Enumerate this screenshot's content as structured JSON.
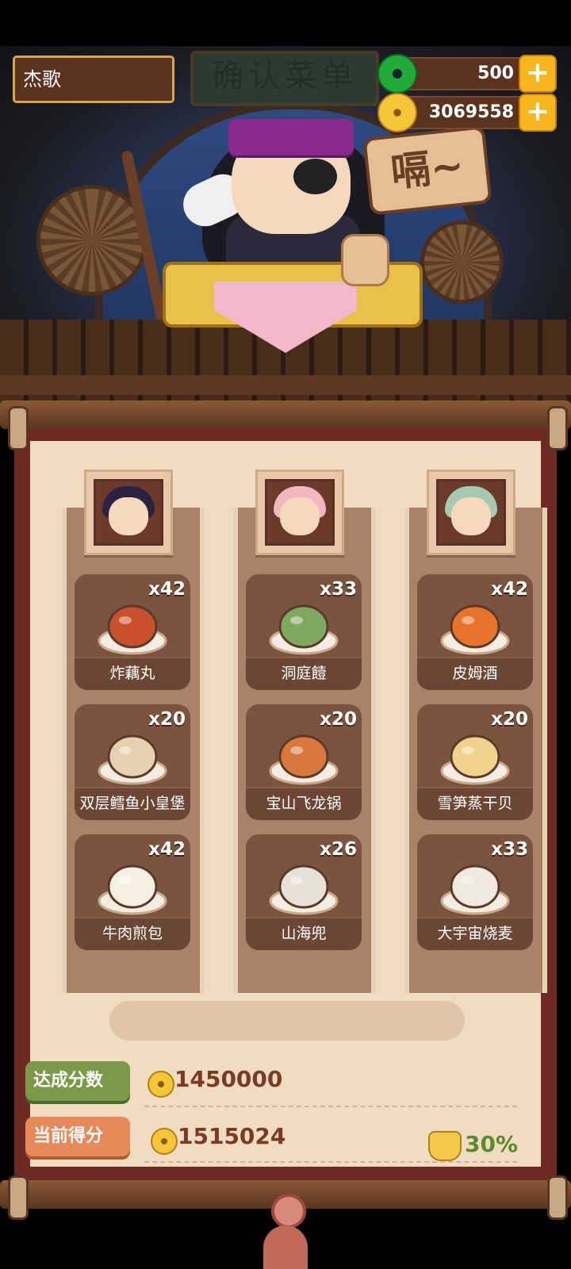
{
  "player": {
    "name": "杰歌"
  },
  "resources": {
    "jade": {
      "value": "500",
      "icon": "jade-coin-icon"
    },
    "coins": {
      "value": "3069558",
      "icon": "gold-coin-icon"
    }
  },
  "scene": {
    "sign_text": "确认菜单",
    "speech_text": "嗝~"
  },
  "customers": [
    {
      "name": "customer-1",
      "hair_color": "#2a2240"
    },
    {
      "name": "customer-2",
      "hair_color": "#f2b8c0"
    },
    {
      "name": "customer-3",
      "hair_color": "#a6c9b2"
    }
  ],
  "dishes": [
    [
      {
        "name": "炸藕丸",
        "count": "x42",
        "color": "#c8502c"
      },
      {
        "name": "双层鳕鱼小皇堡",
        "count": "x20",
        "color": "#e6d2b0"
      },
      {
        "name": "牛肉煎包",
        "count": "x42",
        "color": "#f7efe2"
      }
    ],
    [
      {
        "name": "洞庭饐",
        "count": "x33",
        "color": "#7fa860"
      },
      {
        "name": "宝山飞龙锅",
        "count": "x20",
        "color": "#d9783e"
      },
      {
        "name": "山海兜",
        "count": "x26",
        "color": "#e8e2d6"
      }
    ],
    [
      {
        "name": "皮姆酒",
        "count": "x42",
        "color": "#e8742c"
      },
      {
        "name": "雪笋蒸干贝",
        "count": "x20",
        "color": "#f2d28a"
      },
      {
        "name": "大宇宙烧麦",
        "count": "x33",
        "color": "#f1e8df"
      }
    ]
  ],
  "score": {
    "target_label": "达成分数",
    "target_value": "1450000",
    "current_label": "当前得分",
    "current_value": "1515024",
    "bonus_percent": "30%"
  }
}
